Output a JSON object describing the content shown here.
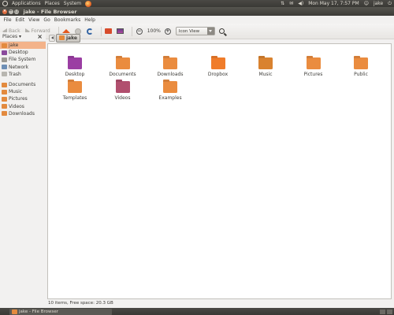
{
  "top_panel": {
    "menus": [
      "Applications",
      "Places",
      "System"
    ],
    "clock": "Mon May 17,  7:57 PM",
    "user": "jake"
  },
  "window": {
    "title": "jake - File Browser",
    "menubar": [
      "File",
      "Edit",
      "View",
      "Go",
      "Bookmarks",
      "Help"
    ]
  },
  "toolbar": {
    "back_label": "Back",
    "forward_label": "Forward",
    "zoom_level": "100%",
    "view_mode": "Icon View"
  },
  "sidebar": {
    "header": "Places",
    "items": [
      {
        "label": "jake",
        "active": true,
        "color": "#e38a3e"
      },
      {
        "label": "Desktop",
        "color": "#8a4a9c"
      },
      {
        "label": "File System",
        "color": "#9b9992"
      },
      {
        "label": "Network",
        "color": "#6e8fb5"
      },
      {
        "label": "Trash",
        "color": "#b8b6b0"
      },
      {
        "label": "Documents",
        "color": "#e38a3e"
      },
      {
        "label": "Music",
        "color": "#e38a3e"
      },
      {
        "label": "Pictures",
        "color": "#e38a3e"
      },
      {
        "label": "Videos",
        "color": "#e38a3e"
      },
      {
        "label": "Downloads",
        "color": "#e38a3e"
      }
    ]
  },
  "pathbar": {
    "current": "jake"
  },
  "files": [
    {
      "name": "Desktop",
      "color": "#9b3ea3"
    },
    {
      "name": "Documents",
      "color": "#ea8c3f"
    },
    {
      "name": "Downloads",
      "color": "#ea8c3f"
    },
    {
      "name": "Dropbox",
      "color": "#f07c2a"
    },
    {
      "name": "Music",
      "color": "#d9822f"
    },
    {
      "name": "Pictures",
      "color": "#ea8c3f"
    },
    {
      "name": "Public",
      "color": "#ea8c3f"
    },
    {
      "name": "Templates",
      "color": "#ea8c3f"
    },
    {
      "name": "Videos",
      "color": "#b14f6e"
    },
    {
      "name": "Examples",
      "color": "#ea8c3f"
    }
  ],
  "status": "10 items, Free space: 20.3 GB",
  "taskbar": {
    "task_label": "jake - File Browser"
  }
}
